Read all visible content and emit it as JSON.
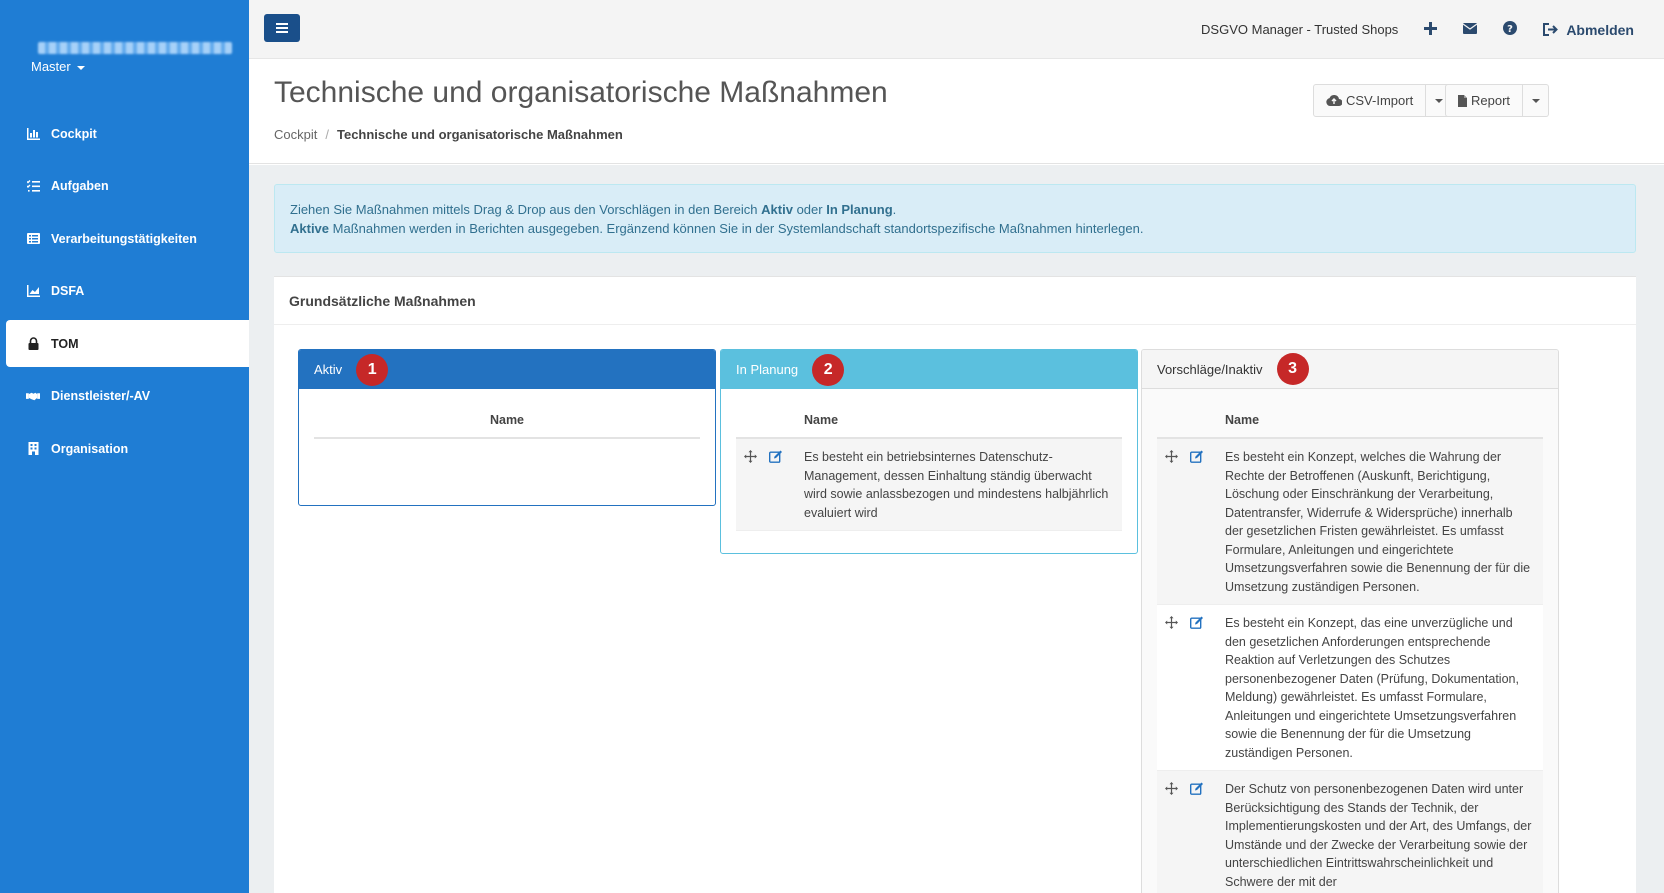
{
  "sidebar": {
    "account": "Master",
    "items": [
      {
        "label": "Cockpit",
        "icon": "chart-icon",
        "active": false
      },
      {
        "label": "Aufgaben",
        "icon": "tasks-icon",
        "active": false
      },
      {
        "label": "Verarbeitungstätigkeiten",
        "icon": "list-icon",
        "active": false
      },
      {
        "label": "DSFA",
        "icon": "area-chart-icon",
        "active": false
      },
      {
        "label": "TOM",
        "icon": "lock-icon",
        "active": true
      },
      {
        "label": "Dienstleister/-AV",
        "icon": "handshake-icon",
        "active": false
      },
      {
        "label": "Organisation",
        "icon": "building-icon",
        "active": false
      }
    ]
  },
  "topbar": {
    "app_name": "DSGVO Manager - Trusted Shops",
    "logout_label": "Abmelden"
  },
  "header": {
    "title": "Technische und organisatorische Maßnahmen",
    "breadcrumb": [
      "Cockpit",
      "Technische und organisatorische Maßnahmen"
    ],
    "csv_import_label": "CSV-Import",
    "report_label": "Report"
  },
  "info": {
    "line1_a": "Ziehen Sie Maßnahmen mittels Drag & Drop aus den Vorschlägen in den Bereich ",
    "line1_b": "Aktiv",
    "line1_c": " oder ",
    "line1_d": "In Planung",
    "line1_e": ".",
    "line2_a": "Aktive",
    "line2_b": " Maßnahmen werden in Berichten ausgegeben. Ergänzend können Sie in der Systemlandschaft standortspezifische Maßnahmen hinterlegen."
  },
  "section": {
    "title": "Grundsätzliche Maßnahmen",
    "panels": [
      {
        "title": "Aktiv",
        "badge": "1",
        "column": "Name",
        "rows": []
      },
      {
        "title": "In Planung",
        "badge": "2",
        "column": "Name",
        "rows": [
          "Es besteht ein betriebsinternes Datenschutz-Management, dessen Einhaltung ständig überwacht wird sowie anlassbezogen und mindestens halbjährlich evaluiert wird"
        ]
      },
      {
        "title": "Vorschläge/Inaktiv",
        "badge": "3",
        "column": "Name",
        "rows": [
          "Es besteht ein Konzept, welches die Wahrung der Rechte der Betroffenen (Auskunft, Berichtigung, Löschung oder Einschränkung der Verarbeitung, Datentransfer, Widerrufe & Widersprüche) innerhalb der gesetzlichen Fristen gewährleistet. Es umfasst Formulare, Anleitungen und eingerichtete Umsetzungsverfahren sowie die Benennung der für die Umsetzung zuständigen Personen.",
          "Es besteht ein Konzept, das eine unverzügliche und den gesetzlichen Anforderungen entsprechende Reaktion auf Verletzungen des Schutzes personenbezogener Daten (Prüfung, Dokumentation, Meldung) gewährleistet. Es umfasst Formulare, Anleitungen und eingerichtete Umsetzungsverfahren sowie die Benennung der für die Umsetzung zuständigen Personen.",
          "Der Schutz von personenbezogenen Daten wird unter Berücksichtigung des Stands der Technik, der Implementierungskosten und der Art, des Umfangs, der Umstände und der Zwecke der Verarbeitung sowie der unterschiedlichen Eintrittswahrscheinlichkeit und Schwere der mit der"
        ]
      }
    ]
  },
  "colors": {
    "sidebar": "#1f7dd4",
    "aktiv": "#2372c0",
    "planung": "#5bc0de",
    "badge": "#c62828"
  }
}
